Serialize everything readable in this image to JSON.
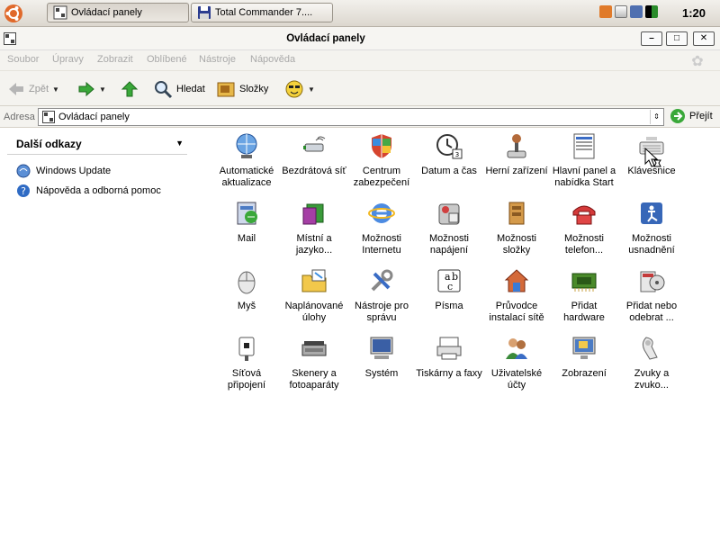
{
  "taskbar": {
    "tasks": [
      {
        "label": "Ovládací panely",
        "active": true
      },
      {
        "label": "Total Commander 7....",
        "active": false
      }
    ],
    "clock": "1:20"
  },
  "window": {
    "title": "Ovládací panely",
    "buttons": {
      "minimize": "–",
      "maximize": "□",
      "close": "✕"
    }
  },
  "menubar": {
    "items": [
      "Soubor",
      "Úpravy",
      "Zobrazit",
      "Oblíbené",
      "Nástroje",
      "Nápověda"
    ]
  },
  "toolbar": {
    "back_label": "Zpět",
    "search_label": "Hledat",
    "folders_label": "Složky"
  },
  "address": {
    "label": "Adresa",
    "value": "Ovládací panely",
    "go_label": "Přejít"
  },
  "sidebar": {
    "header": "Další odkazy",
    "links": [
      "Windows Update",
      "Nápověda a odborná pomoc"
    ]
  },
  "items": [
    {
      "label": "Automatické aktualizace",
      "icon": "globe-update-icon"
    },
    {
      "label": "Bezdrátová síť",
      "icon": "wireless-adapter-icon"
    },
    {
      "label": "Centrum zabezpečení",
      "icon": "security-shield-icon"
    },
    {
      "label": "Datum a čas",
      "icon": "clock-calendar-icon"
    },
    {
      "label": "Herní zařízení",
      "icon": "joystick-icon"
    },
    {
      "label": "Hlavní panel a nabídka Start",
      "icon": "taskbar-start-icon"
    },
    {
      "label": "Klávesnice",
      "icon": "keyboard-icon"
    },
    {
      "label": "Mail",
      "icon": "mail-icon"
    },
    {
      "label": "Místní a jazyko...",
      "icon": "regional-language-icon"
    },
    {
      "label": "Možnosti Internetu",
      "icon": "internet-explorer-icon"
    },
    {
      "label": "Možnosti napájení",
      "icon": "power-options-icon"
    },
    {
      "label": "Možnosti složky",
      "icon": "folder-options-icon"
    },
    {
      "label": "Možnosti telefon...",
      "icon": "phone-modem-icon"
    },
    {
      "label": "Možnosti usnadnění",
      "icon": "accessibility-icon"
    },
    {
      "label": "Myš",
      "icon": "mouse-icon"
    },
    {
      "label": "Naplánované úlohy",
      "icon": "scheduled-tasks-icon"
    },
    {
      "label": "Nástroje pro správu",
      "icon": "admin-tools-icon"
    },
    {
      "label": "Písma",
      "icon": "fonts-icon"
    },
    {
      "label": "Průvodce instalací sítě",
      "icon": "network-wizard-icon"
    },
    {
      "label": "Přidat hardware",
      "icon": "add-hardware-icon"
    },
    {
      "label": "Přidat nebo odebrat ...",
      "icon": "add-remove-programs-icon"
    },
    {
      "label": "Síťová připojení",
      "icon": "network-connections-icon"
    },
    {
      "label": "Skenery a fotoaparáty",
      "icon": "scanner-camera-icon"
    },
    {
      "label": "Systém",
      "icon": "system-computer-icon"
    },
    {
      "label": "Tiskárny a faxy",
      "icon": "printer-fax-icon"
    },
    {
      "label": "Uživatelské účty",
      "icon": "user-accounts-icon"
    },
    {
      "label": "Zobrazení",
      "icon": "display-icon"
    },
    {
      "label": "Zvuky a zvuko...",
      "icon": "sounds-audio-icon"
    }
  ]
}
